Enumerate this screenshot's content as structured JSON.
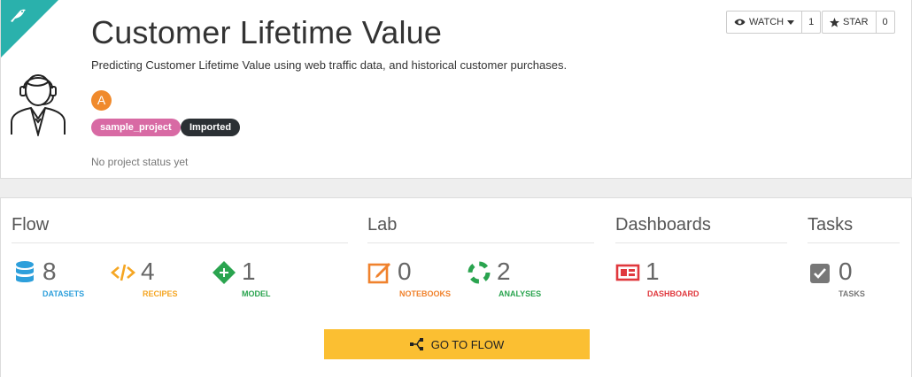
{
  "header": {
    "title": "Customer Lifetime Value",
    "description": "Predicting Customer Lifetime Value using web traffic data, and historical customer purchases.",
    "user_initial": "A",
    "tags": [
      "sample_project",
      "Imported"
    ],
    "status": "No project status yet",
    "watch": {
      "label": "WATCH",
      "count": "1"
    },
    "star": {
      "label": "STAR",
      "count": "0"
    }
  },
  "sections": {
    "flow": "Flow",
    "lab": "Lab",
    "dashboards": "Dashboards",
    "tasks": "Tasks"
  },
  "stats": {
    "datasets": {
      "value": "8",
      "label": "DATASETS",
      "color": "#2d9fdb"
    },
    "recipes": {
      "value": "4",
      "label": "RECIPES",
      "color": "#f5a623"
    },
    "model": {
      "value": "1",
      "label": "MODEL",
      "color": "#2aa44f"
    },
    "notebooks": {
      "value": "0",
      "label": "NOTEBOOKS",
      "color": "#f0822d"
    },
    "analyses": {
      "value": "2",
      "label": "ANALYSES",
      "color": "#2aa44f"
    },
    "dashboard": {
      "value": "1",
      "label": "DASHBOARD",
      "color": "#e0383d"
    },
    "tasks": {
      "value": "0",
      "label": "TASKS",
      "color": "#777777"
    }
  },
  "go_to_flow": "GO TO FLOW",
  "icons": {
    "ribbon": "bird-icon",
    "project": "support-agent-icon",
    "watch": "eye-icon",
    "star": "star-icon"
  }
}
